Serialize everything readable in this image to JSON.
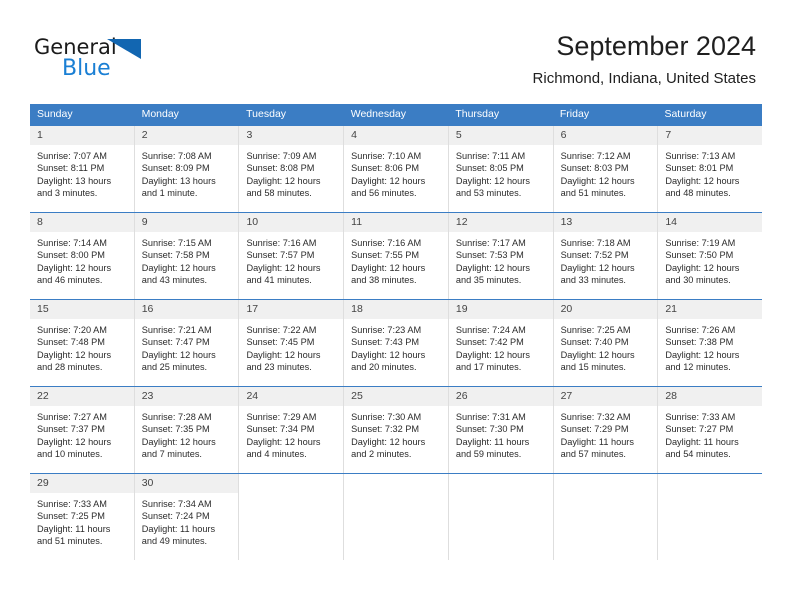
{
  "brand": {
    "name_part1": "General",
    "name_part2": "Blue",
    "triangle_icon": "triangle-icon",
    "accent_color": "#1a7fd4",
    "logo_triangle_color": "#1266b1"
  },
  "header": {
    "title": "September 2024",
    "subtitle": "Richmond, Indiana, United States"
  },
  "theme": {
    "header_bar_color": "#3b7dc4",
    "day_number_band_color": "#f0f0f0",
    "cell_border_color": "#dedede"
  },
  "weekdays": [
    "Sunday",
    "Monday",
    "Tuesday",
    "Wednesday",
    "Thursday",
    "Friday",
    "Saturday"
  ],
  "weeks": [
    [
      {
        "day": "1",
        "sunrise": "Sunrise: 7:07 AM",
        "sunset": "Sunset: 8:11 PM",
        "daylight_line1": "Daylight: 13 hours",
        "daylight_line2": "and 3 minutes."
      },
      {
        "day": "2",
        "sunrise": "Sunrise: 7:08 AM",
        "sunset": "Sunset: 8:09 PM",
        "daylight_line1": "Daylight: 13 hours",
        "daylight_line2": "and 1 minute."
      },
      {
        "day": "3",
        "sunrise": "Sunrise: 7:09 AM",
        "sunset": "Sunset: 8:08 PM",
        "daylight_line1": "Daylight: 12 hours",
        "daylight_line2": "and 58 minutes."
      },
      {
        "day": "4",
        "sunrise": "Sunrise: 7:10 AM",
        "sunset": "Sunset: 8:06 PM",
        "daylight_line1": "Daylight: 12 hours",
        "daylight_line2": "and 56 minutes."
      },
      {
        "day": "5",
        "sunrise": "Sunrise: 7:11 AM",
        "sunset": "Sunset: 8:05 PM",
        "daylight_line1": "Daylight: 12 hours",
        "daylight_line2": "and 53 minutes."
      },
      {
        "day": "6",
        "sunrise": "Sunrise: 7:12 AM",
        "sunset": "Sunset: 8:03 PM",
        "daylight_line1": "Daylight: 12 hours",
        "daylight_line2": "and 51 minutes."
      },
      {
        "day": "7",
        "sunrise": "Sunrise: 7:13 AM",
        "sunset": "Sunset: 8:01 PM",
        "daylight_line1": "Daylight: 12 hours",
        "daylight_line2": "and 48 minutes."
      }
    ],
    [
      {
        "day": "8",
        "sunrise": "Sunrise: 7:14 AM",
        "sunset": "Sunset: 8:00 PM",
        "daylight_line1": "Daylight: 12 hours",
        "daylight_line2": "and 46 minutes."
      },
      {
        "day": "9",
        "sunrise": "Sunrise: 7:15 AM",
        "sunset": "Sunset: 7:58 PM",
        "daylight_line1": "Daylight: 12 hours",
        "daylight_line2": "and 43 minutes."
      },
      {
        "day": "10",
        "sunrise": "Sunrise: 7:16 AM",
        "sunset": "Sunset: 7:57 PM",
        "daylight_line1": "Daylight: 12 hours",
        "daylight_line2": "and 41 minutes."
      },
      {
        "day": "11",
        "sunrise": "Sunrise: 7:16 AM",
        "sunset": "Sunset: 7:55 PM",
        "daylight_line1": "Daylight: 12 hours",
        "daylight_line2": "and 38 minutes."
      },
      {
        "day": "12",
        "sunrise": "Sunrise: 7:17 AM",
        "sunset": "Sunset: 7:53 PM",
        "daylight_line1": "Daylight: 12 hours",
        "daylight_line2": "and 35 minutes."
      },
      {
        "day": "13",
        "sunrise": "Sunrise: 7:18 AM",
        "sunset": "Sunset: 7:52 PM",
        "daylight_line1": "Daylight: 12 hours",
        "daylight_line2": "and 33 minutes."
      },
      {
        "day": "14",
        "sunrise": "Sunrise: 7:19 AM",
        "sunset": "Sunset: 7:50 PM",
        "daylight_line1": "Daylight: 12 hours",
        "daylight_line2": "and 30 minutes."
      }
    ],
    [
      {
        "day": "15",
        "sunrise": "Sunrise: 7:20 AM",
        "sunset": "Sunset: 7:48 PM",
        "daylight_line1": "Daylight: 12 hours",
        "daylight_line2": "and 28 minutes."
      },
      {
        "day": "16",
        "sunrise": "Sunrise: 7:21 AM",
        "sunset": "Sunset: 7:47 PM",
        "daylight_line1": "Daylight: 12 hours",
        "daylight_line2": "and 25 minutes."
      },
      {
        "day": "17",
        "sunrise": "Sunrise: 7:22 AM",
        "sunset": "Sunset: 7:45 PM",
        "daylight_line1": "Daylight: 12 hours",
        "daylight_line2": "and 23 minutes."
      },
      {
        "day": "18",
        "sunrise": "Sunrise: 7:23 AM",
        "sunset": "Sunset: 7:43 PM",
        "daylight_line1": "Daylight: 12 hours",
        "daylight_line2": "and 20 minutes."
      },
      {
        "day": "19",
        "sunrise": "Sunrise: 7:24 AM",
        "sunset": "Sunset: 7:42 PM",
        "daylight_line1": "Daylight: 12 hours",
        "daylight_line2": "and 17 minutes."
      },
      {
        "day": "20",
        "sunrise": "Sunrise: 7:25 AM",
        "sunset": "Sunset: 7:40 PM",
        "daylight_line1": "Daylight: 12 hours",
        "daylight_line2": "and 15 minutes."
      },
      {
        "day": "21",
        "sunrise": "Sunrise: 7:26 AM",
        "sunset": "Sunset: 7:38 PM",
        "daylight_line1": "Daylight: 12 hours",
        "daylight_line2": "and 12 minutes."
      }
    ],
    [
      {
        "day": "22",
        "sunrise": "Sunrise: 7:27 AM",
        "sunset": "Sunset: 7:37 PM",
        "daylight_line1": "Daylight: 12 hours",
        "daylight_line2": "and 10 minutes."
      },
      {
        "day": "23",
        "sunrise": "Sunrise: 7:28 AM",
        "sunset": "Sunset: 7:35 PM",
        "daylight_line1": "Daylight: 12 hours",
        "daylight_line2": "and 7 minutes."
      },
      {
        "day": "24",
        "sunrise": "Sunrise: 7:29 AM",
        "sunset": "Sunset: 7:34 PM",
        "daylight_line1": "Daylight: 12 hours",
        "daylight_line2": "and 4 minutes."
      },
      {
        "day": "25",
        "sunrise": "Sunrise: 7:30 AM",
        "sunset": "Sunset: 7:32 PM",
        "daylight_line1": "Daylight: 12 hours",
        "daylight_line2": "and 2 minutes."
      },
      {
        "day": "26",
        "sunrise": "Sunrise: 7:31 AM",
        "sunset": "Sunset: 7:30 PM",
        "daylight_line1": "Daylight: 11 hours",
        "daylight_line2": "and 59 minutes."
      },
      {
        "day": "27",
        "sunrise": "Sunrise: 7:32 AM",
        "sunset": "Sunset: 7:29 PM",
        "daylight_line1": "Daylight: 11 hours",
        "daylight_line2": "and 57 minutes."
      },
      {
        "day": "28",
        "sunrise": "Sunrise: 7:33 AM",
        "sunset": "Sunset: 7:27 PM",
        "daylight_line1": "Daylight: 11 hours",
        "daylight_line2": "and 54 minutes."
      }
    ],
    [
      {
        "day": "29",
        "sunrise": "Sunrise: 7:33 AM",
        "sunset": "Sunset: 7:25 PM",
        "daylight_line1": "Daylight: 11 hours",
        "daylight_line2": "and 51 minutes."
      },
      {
        "day": "30",
        "sunrise": "Sunrise: 7:34 AM",
        "sunset": "Sunset: 7:24 PM",
        "daylight_line1": "Daylight: 11 hours",
        "daylight_line2": "and 49 minutes."
      },
      {
        "day": "",
        "sunrise": "",
        "sunset": "",
        "daylight_line1": "",
        "daylight_line2": ""
      },
      {
        "day": "",
        "sunrise": "",
        "sunset": "",
        "daylight_line1": "",
        "daylight_line2": ""
      },
      {
        "day": "",
        "sunrise": "",
        "sunset": "",
        "daylight_line1": "",
        "daylight_line2": ""
      },
      {
        "day": "",
        "sunrise": "",
        "sunset": "",
        "daylight_line1": "",
        "daylight_line2": ""
      },
      {
        "day": "",
        "sunrise": "",
        "sunset": "",
        "daylight_line1": "",
        "daylight_line2": ""
      }
    ]
  ]
}
